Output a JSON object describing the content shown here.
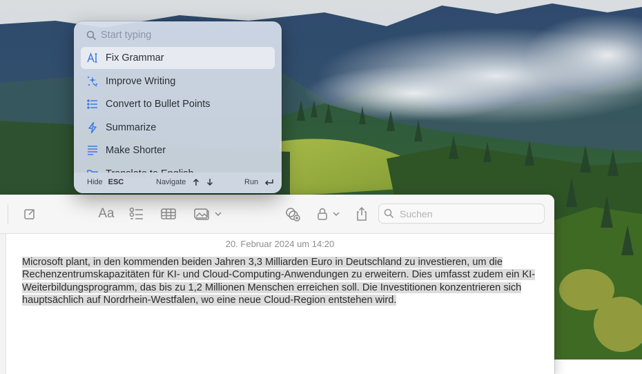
{
  "palette": {
    "search_placeholder": "Start typing",
    "items": [
      {
        "label": "Fix Grammar",
        "icon": "fix-grammar-icon"
      },
      {
        "label": "Improve Writing",
        "icon": "sparkles-icon"
      },
      {
        "label": "Convert to Bullet Points",
        "icon": "bullet-list-icon"
      },
      {
        "label": "Summarize",
        "icon": "bolt-icon"
      },
      {
        "label": "Make Shorter",
        "icon": "lines-shorter-icon"
      },
      {
        "label": "Translate to English",
        "icon": "folder-icon"
      }
    ],
    "footer": {
      "hide_label": "Hide",
      "hide_key": "ESC",
      "navigate_label": "Navigate",
      "run_label": "Run"
    },
    "accent_color": "#3b7ae6"
  },
  "notes": {
    "search_placeholder": "Suchen",
    "date": "20. Februar 2024 um 14:20",
    "body": "Microsoft plant, in den kommenden beiden Jahren 3,3 Milliarden Euro in Deutschland zu investieren, um die Rechenzentrumskapazitäten für KI- und Cloud-Computing-Anwendungen zu erweitern. Dies umfasst zudem ein KI-Weiterbildungsprogramm, das bis zu 1,2 Millionen Menschen erreichen soll. Die Investitionen konzentrieren sich hauptsächlich auf Nordrhein-Westfalen, wo eine neue Cloud-Region entstehen wird.",
    "toolbar_icons": [
      "compose-icon",
      "font-format-icon",
      "checklist-icon",
      "table-icon",
      "media-icon",
      "collaborate-icon",
      "lock-icon",
      "share-icon",
      "search-icon"
    ]
  }
}
